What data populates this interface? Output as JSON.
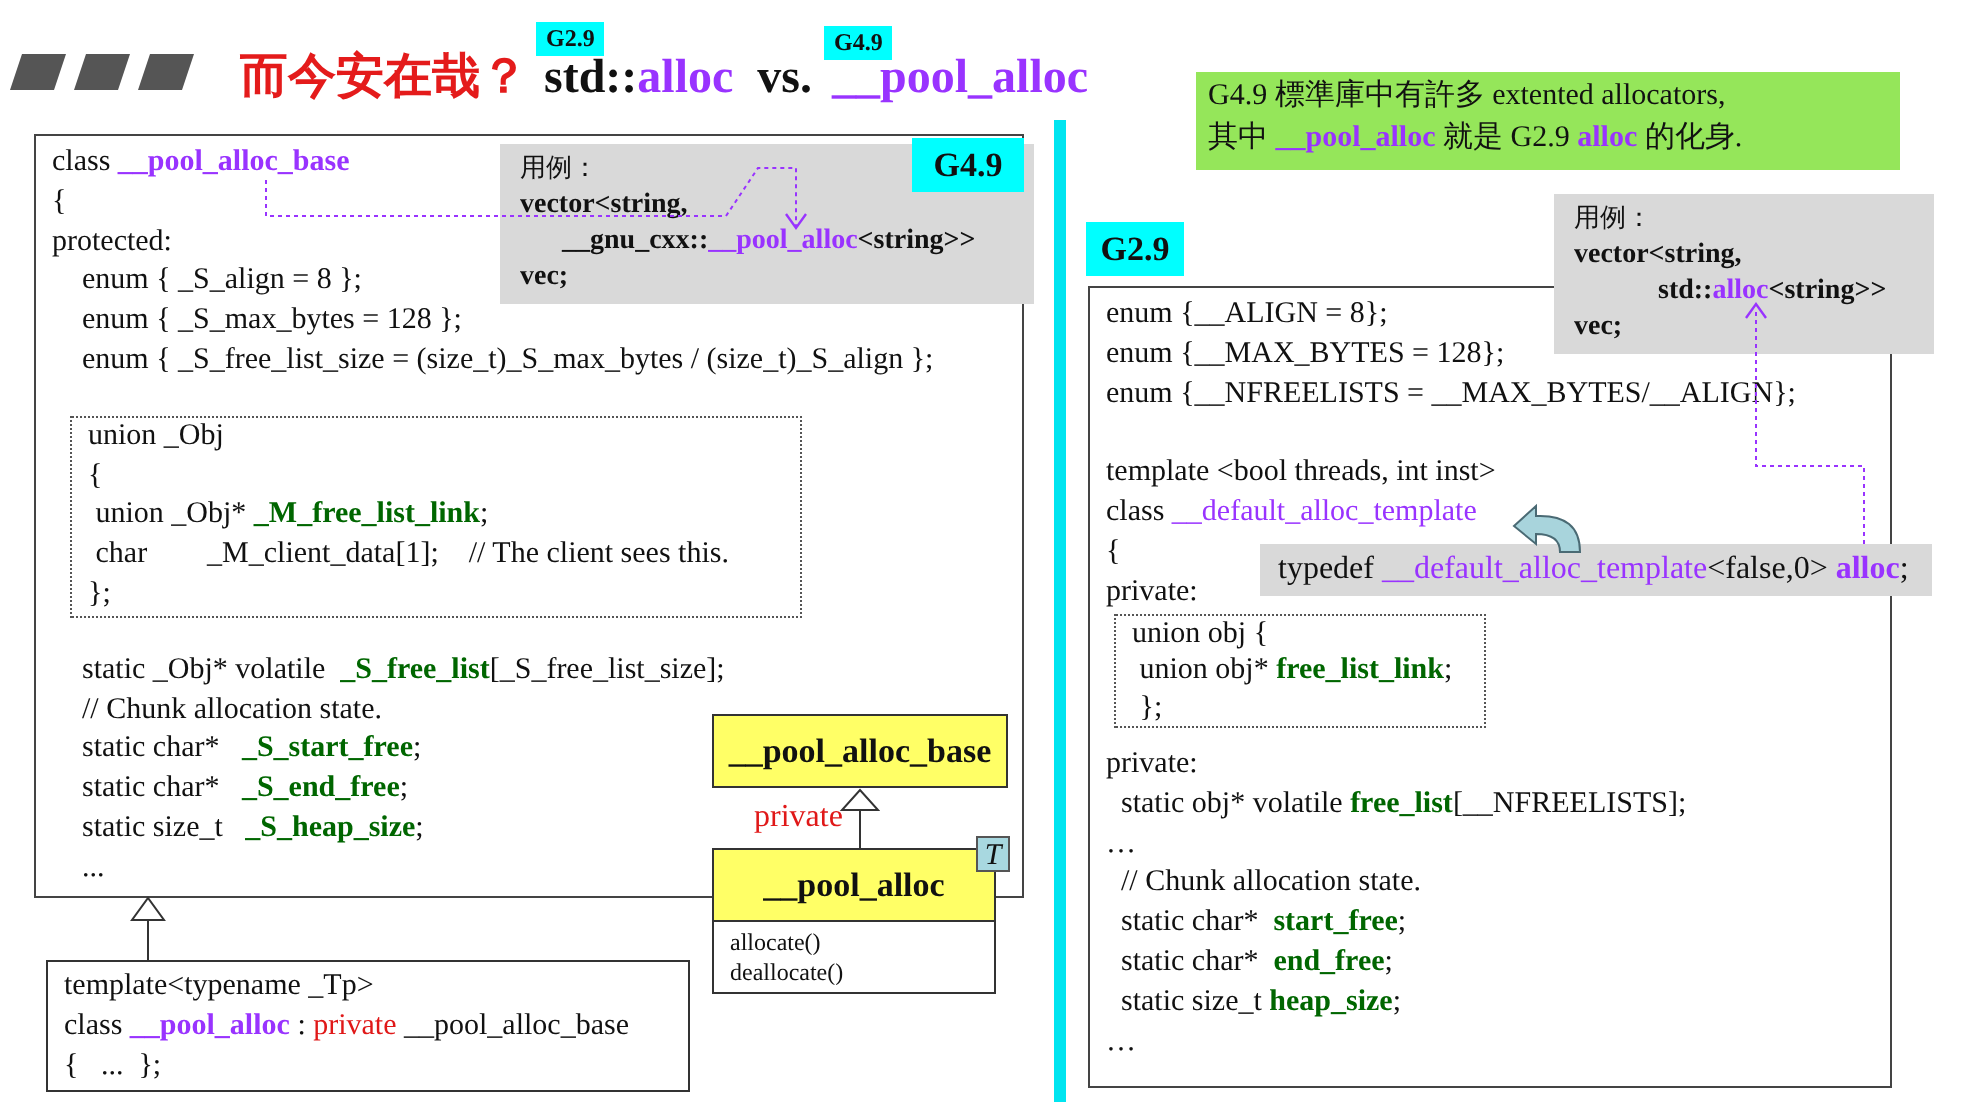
{
  "title": {
    "question": "而今安在哉？",
    "left": {
      "badge": "G2.9",
      "segments": [
        {
          "text": "std::",
          "kind": "bold"
        },
        {
          "text": "alloc",
          "kind": "name"
        }
      ]
    },
    "vs": "vs.",
    "right": {
      "badge": "G4.9",
      "segments": [
        {
          "text": "__pool_alloc",
          "kind": "name"
        }
      ]
    }
  },
  "note": [
    [
      {
        "text": "G4.9 標準庫中有許多 extented allocators,",
        "kind": "plain"
      }
    ],
    [
      {
        "text": "其中 ",
        "kind": "plain"
      },
      {
        "text": "__pool_alloc",
        "kind": "name"
      },
      {
        "text": " 就是 G2.9 ",
        "kind": "plain"
      },
      {
        "text": "alloc",
        "kind": "name"
      },
      {
        "text": " 的化身.",
        "kind": "plain"
      }
    ]
  ],
  "g49_panel": {
    "badge": "G4.9",
    "sections": [
      {
        "kind": "lines",
        "lines": [
          [
            {
              "text": "class ",
              "kind": "plain"
            },
            {
              "text": "__pool_alloc_base",
              "kind": "name"
            }
          ],
          [
            {
              "text": "{",
              "kind": "plain"
            }
          ],
          [
            {
              "text": "protected:",
              "kind": "plain"
            }
          ],
          [
            {
              "text": "    enum { _S_align = 8 };",
              "kind": "plain"
            }
          ],
          [
            {
              "text": "    enum { _S_max_bytes = 128 };",
              "kind": "plain"
            }
          ],
          [
            {
              "text": "    enum { _S_free_list_size = (size_t)_S_max_bytes / (size_t)_S_align };",
              "kind": "plain"
            }
          ]
        ]
      },
      {
        "kind": "union",
        "lines": [
          [
            {
              "text": "union _Obj",
              "kind": "plain"
            }
          ],
          [
            {
              "text": "{",
              "kind": "plain"
            }
          ],
          [
            {
              "text": " union _Obj* ",
              "kind": "plain"
            },
            {
              "text": "_M_free_list_link",
              "kind": "member"
            },
            {
              "text": ";",
              "kind": "plain"
            }
          ],
          [
            {
              "text": " char        _M_client_data[1];    // The client sees this.",
              "kind": "plain"
            }
          ],
          [
            {
              "text": "};",
              "kind": "plain"
            }
          ]
        ]
      },
      {
        "kind": "lines",
        "lines": [
          [
            {
              "text": "    static _Obj* volatile  ",
              "kind": "plain"
            },
            {
              "text": "_S_free_list",
              "kind": "member"
            },
            {
              "text": "[_S_free_list_size];",
              "kind": "plain"
            }
          ],
          [
            {
              "text": "    // Chunk allocation state.",
              "kind": "plain"
            }
          ],
          [
            {
              "text": "    static char*   ",
              "kind": "plain"
            },
            {
              "text": "_S_start_free",
              "kind": "member"
            },
            {
              "text": ";",
              "kind": "plain"
            }
          ],
          [
            {
              "text": "    static char*   ",
              "kind": "plain"
            },
            {
              "text": "_S_end_free",
              "kind": "member"
            },
            {
              "text": ";",
              "kind": "plain"
            }
          ],
          [
            {
              "text": "    static size_t   ",
              "kind": "plain"
            },
            {
              "text": "_S_heap_size",
              "kind": "member"
            },
            {
              "text": ";",
              "kind": "plain"
            }
          ],
          [
            {
              "text": "    ...",
              "kind": "plain"
            }
          ]
        ]
      }
    ]
  },
  "usage_g49": {
    "label": "用例：",
    "lines": [
      [
        {
          "text": "vector<string,",
          "kind": "bold"
        }
      ],
      [
        {
          "text": "      __gnu_cxx::",
          "kind": "bold"
        },
        {
          "text": "__pool_alloc",
          "kind": "name"
        },
        {
          "text": "<string>>",
          "kind": "bold"
        }
      ],
      [
        {
          "text": "vec;",
          "kind": "bold"
        }
      ]
    ]
  },
  "uml": {
    "base": "__pool_alloc_base",
    "relation": "private",
    "derived": "__pool_alloc",
    "template_param": "T",
    "methods": [
      "allocate()",
      "deallocate()"
    ]
  },
  "derived_decl": [
    [
      {
        "text": "template<typename _Tp>",
        "kind": "plain"
      }
    ],
    [
      {
        "text": "class ",
        "kind": "plain"
      },
      {
        "text": "__pool_alloc",
        "kind": "name"
      },
      {
        "text": " : ",
        "kind": "plain"
      },
      {
        "text": "private",
        "kind": "access"
      },
      {
        "text": " __pool_alloc_base",
        "kind": "plain"
      }
    ],
    [
      {
        "text": "{   ...  };",
        "kind": "plain"
      }
    ]
  ],
  "g29_panel": {
    "badge": "G2.9",
    "sections": [
      {
        "kind": "lines",
        "lines": [
          [
            {
              "text": "enum {__ALIGN = 8};",
              "kind": "plain"
            }
          ],
          [
            {
              "text": "enum {__MAX_BYTES = 128};",
              "kind": "plain"
            }
          ],
          [
            {
              "text": "enum {__NFREELISTS = __MAX_BYTES/__ALIGN};",
              "kind": "plain"
            }
          ]
        ]
      },
      {
        "kind": "lines",
        "lines": [
          [
            {
              "text": "template <bool threads, int inst>",
              "kind": "plain"
            }
          ],
          [
            {
              "text": "class ",
              "kind": "plain"
            },
            {
              "text": "__default_alloc_template",
              "kind": "name-light"
            }
          ],
          [
            {
              "text": "{",
              "kind": "plain"
            }
          ],
          [
            {
              "text": "private:",
              "kind": "plain"
            }
          ]
        ]
      },
      {
        "kind": "union",
        "lines": [
          [
            {
              "text": "union obj {",
              "kind": "plain"
            }
          ],
          [
            {
              "text": " union obj* ",
              "kind": "plain"
            },
            {
              "text": "free_list_link",
              "kind": "member"
            },
            {
              "text": ";",
              "kind": "plain"
            }
          ],
          [
            {
              "text": " };",
              "kind": "plain"
            }
          ]
        ]
      },
      {
        "kind": "lines",
        "lines": [
          [
            {
              "text": "private:",
              "kind": "plain"
            }
          ],
          [
            {
              "text": "  static obj* volatile ",
              "kind": "plain"
            },
            {
              "text": "free_list",
              "kind": "member"
            },
            {
              "text": "[__NFREELISTS];",
              "kind": "plain"
            }
          ],
          [
            {
              "text": "…",
              "kind": "plain"
            }
          ],
          [
            {
              "text": "  // Chunk allocation state.",
              "kind": "plain"
            }
          ],
          [
            {
              "text": "  static char*  ",
              "kind": "plain"
            },
            {
              "text": "start_free",
              "kind": "member"
            },
            {
              "text": ";",
              "kind": "plain"
            }
          ],
          [
            {
              "text": "  static char*  ",
              "kind": "plain"
            },
            {
              "text": "end_free",
              "kind": "member"
            },
            {
              "text": ";",
              "kind": "plain"
            }
          ],
          [
            {
              "text": "  static size_t ",
              "kind": "plain"
            },
            {
              "text": "heap_size",
              "kind": "member"
            },
            {
              "text": ";",
              "kind": "plain"
            }
          ],
          [
            {
              "text": "…",
              "kind": "plain"
            }
          ]
        ]
      }
    ]
  },
  "usage_g29": {
    "label": "用例：",
    "lines": [
      [
        {
          "text": "vector<string,",
          "kind": "bold"
        }
      ],
      [
        {
          "text": "            std::",
          "kind": "bold"
        },
        {
          "text": "alloc",
          "kind": "name"
        },
        {
          "text": "<string>>",
          "kind": "bold"
        }
      ],
      [
        {
          "text": "vec;",
          "kind": "bold"
        }
      ]
    ]
  },
  "typedef_callout": [
    {
      "text": "typedef ",
      "kind": "plain"
    },
    {
      "text": "__default_alloc_template",
      "kind": "name-light"
    },
    {
      "text": "<false,0> ",
      "kind": "plain"
    },
    {
      "text": "alloc",
      "kind": "name"
    },
    {
      "text": ";",
      "kind": "plain"
    }
  ]
}
